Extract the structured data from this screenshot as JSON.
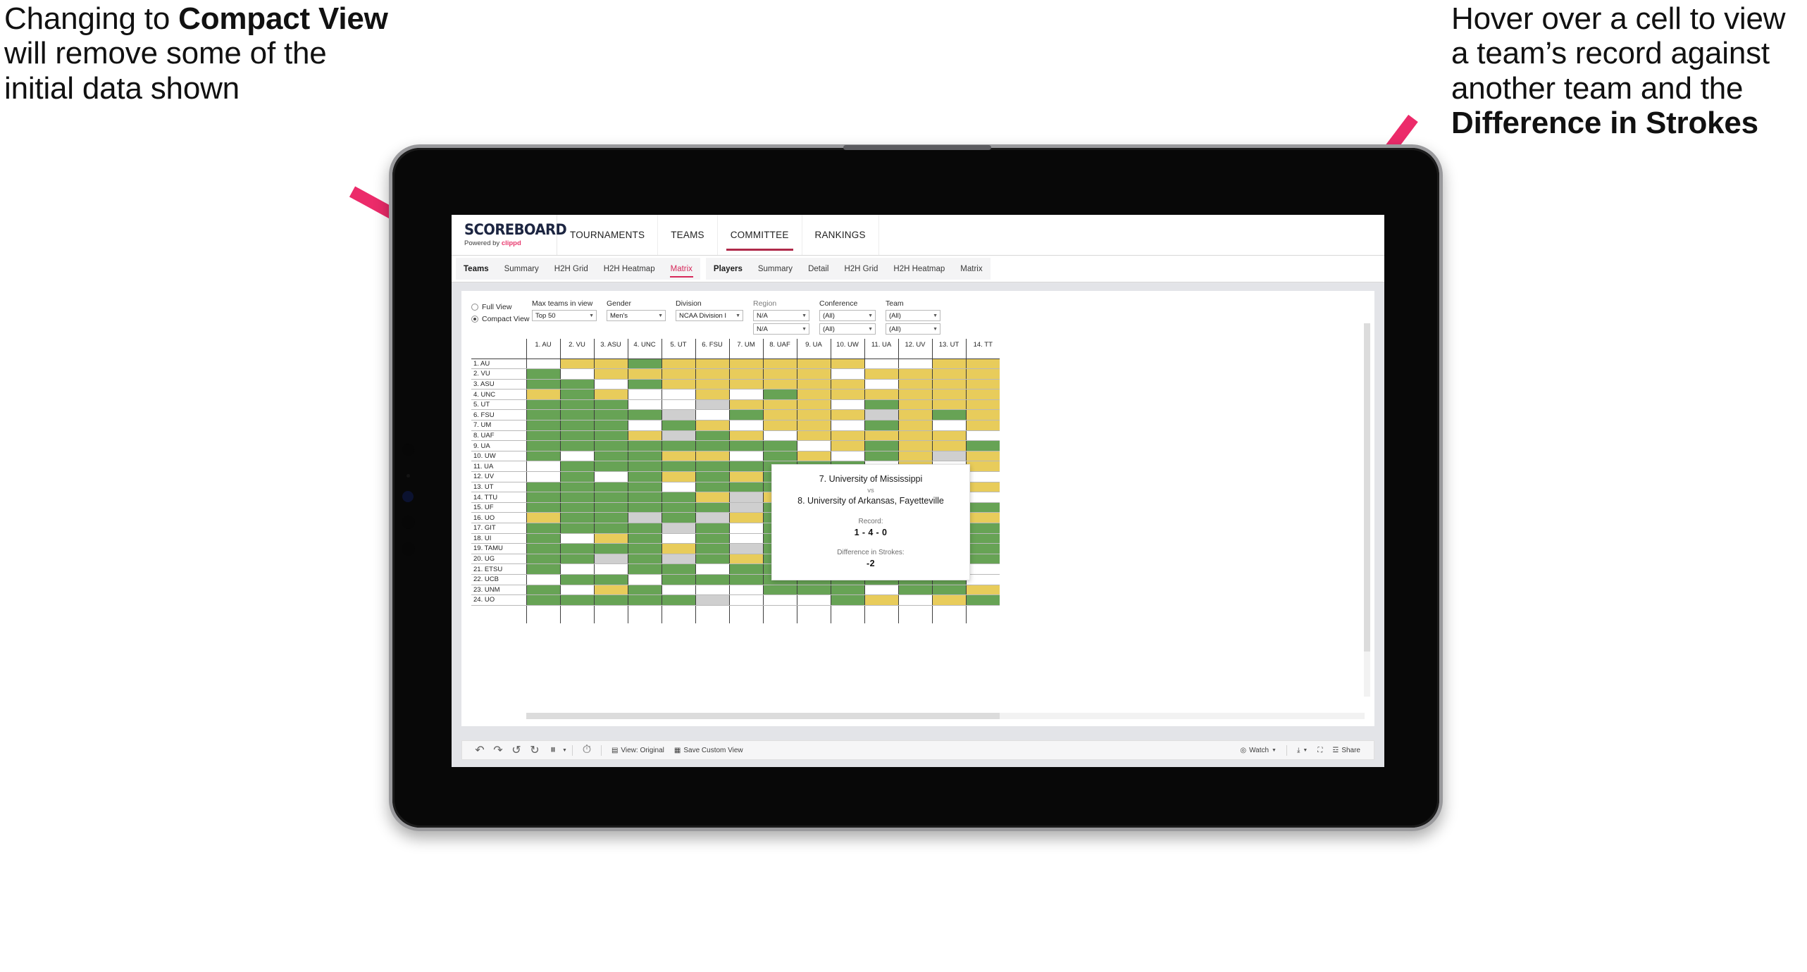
{
  "annotations": {
    "left": {
      "name": "compact-view-callout",
      "segments": [
        {
          "text": "Changing to ",
          "bold": false
        },
        {
          "text": "Compact View",
          "bold": true
        },
        {
          "text": " will remove some of the initial data shown",
          "bold": false
        }
      ]
    },
    "right": {
      "name": "hover-cell-callout",
      "segments": [
        {
          "text": "Hover over a cell to view a team’s record against another team and the ",
          "bold": false
        },
        {
          "text": "Difference in Strokes",
          "bold": true
        }
      ]
    },
    "arrow_color": "#ec2b6a"
  },
  "app": {
    "brand": {
      "logo": "SCOREBOARD",
      "powered_prefix": "Powered by ",
      "powered_brand": "clippd"
    },
    "nav": [
      {
        "label": "TOURNAMENTS",
        "active": false
      },
      {
        "label": "TEAMS",
        "active": false
      },
      {
        "label": "COMMITTEE",
        "active": true
      },
      {
        "label": "RANKINGS",
        "active": false
      }
    ],
    "tab_groups": [
      {
        "name": "teams-tabs",
        "items": [
          {
            "label": "Teams",
            "head": true,
            "selected": false
          },
          {
            "label": "Summary",
            "head": false,
            "selected": false
          },
          {
            "label": "H2H Grid",
            "head": false,
            "selected": false
          },
          {
            "label": "H2H Heatmap",
            "head": false,
            "selected": false
          },
          {
            "label": "Matrix",
            "head": false,
            "selected": true
          }
        ]
      },
      {
        "name": "players-tabs",
        "items": [
          {
            "label": "Players",
            "head": true,
            "selected": false
          },
          {
            "label": "Summary",
            "head": false,
            "selected": false
          },
          {
            "label": "Detail",
            "head": false,
            "selected": false
          },
          {
            "label": "H2H Grid",
            "head": false,
            "selected": false
          },
          {
            "label": "H2H Heatmap",
            "head": false,
            "selected": false
          },
          {
            "label": "Matrix",
            "head": false,
            "selected": false
          }
        ]
      }
    ],
    "filters": {
      "view_mode": {
        "options": [
          {
            "label": "Full View",
            "selected": false
          },
          {
            "label": "Compact View",
            "selected": true
          }
        ]
      },
      "fields": [
        {
          "label": "Max teams in view",
          "dim": false,
          "width": "w92",
          "values": [
            "Top 50"
          ]
        },
        {
          "label": "Gender",
          "dim": false,
          "width": "w84",
          "values": [
            "Men's"
          ]
        },
        {
          "label": "Division",
          "dim": false,
          "width": "w96",
          "values": [
            "NCAA Division I"
          ]
        },
        {
          "label": "Region",
          "dim": true,
          "width": "w80",
          "values": [
            "N/A",
            "N/A"
          ]
        },
        {
          "label": "Conference",
          "dim": false,
          "width": "w80",
          "values": [
            "(All)",
            "(All)"
          ]
        },
        {
          "label": "Team",
          "dim": false,
          "width": "w78",
          "values": [
            "(All)",
            "(All)"
          ]
        }
      ]
    },
    "tooltip": {
      "team_a": "7. University of Mississippi",
      "vs": "vs",
      "team_b": "8. University of Arkansas, Fayetteville",
      "record_label": "Record:",
      "record_value": "1 - 4 - 0",
      "diff_label": "Difference in Strokes:",
      "diff_value": "-2"
    },
    "toolbar": {
      "icons": [
        "undo-icon",
        "redo-icon",
        "revert-icon",
        "refresh-icon",
        "pause-icon",
        "alerts-icon"
      ],
      "items": [
        {
          "name": "view-original-button",
          "icon": "view-icon",
          "label": "View: Original"
        },
        {
          "name": "save-custom-view-button",
          "icon": "save-view-icon",
          "label": "Save Custom View"
        },
        {
          "name": "watch-button",
          "icon": "watch-icon",
          "label": "Watch",
          "caret": true
        },
        {
          "name": "download-button",
          "icon": "download-icon",
          "label": "",
          "caret": true
        },
        {
          "name": "fullscreen-button",
          "icon": "fullscreen-icon",
          "label": ""
        },
        {
          "name": "share-button",
          "icon": "share-icon",
          "label": "Share"
        }
      ]
    }
  },
  "chart_data": {
    "type": "heatmap",
    "title": "Head-to-Head Team Matrix",
    "legend": {
      "green": "#67a355",
      "yellow": "#e8cc5b",
      "gray": "#cfcfcf",
      "white": "#ffffff"
    },
    "xlabel": "",
    "ylabel": "",
    "columns": [
      "1. AU",
      "2. VU",
      "3. ASU",
      "4. UNC",
      "5. UT",
      "6. FSU",
      "7. UM",
      "8. UAF",
      "9. UA",
      "10. UW",
      "11. UA",
      "12. UV",
      "13. UT",
      "14. TT"
    ],
    "rows": [
      "1. AU",
      "2. VU",
      "3. ASU",
      "4. UNC",
      "5. UT",
      "6. FSU",
      "7. UM",
      "8. UAF",
      "9. UA",
      "10. UW",
      "11. UA",
      "12. UV",
      "13. UT",
      "14. TTU",
      "15. UF",
      "16. UO",
      "17. GIT",
      "18. UI",
      "19. TAMU",
      "20. UG",
      "21. ETSU",
      "22. UCB",
      "23. UNM",
      "24. UO"
    ],
    "cells": [
      [
        "w",
        "y",
        "y",
        "g",
        "y",
        "y",
        "y",
        "y",
        "y",
        "y",
        "w",
        "w",
        "y",
        "y"
      ],
      [
        "g",
        "w",
        "y",
        "y",
        "y",
        "y",
        "y",
        "y",
        "y",
        "w",
        "y",
        "y",
        "y",
        "y"
      ],
      [
        "g",
        "g",
        "w",
        "g",
        "y",
        "y",
        "y",
        "y",
        "y",
        "y",
        "w",
        "y",
        "y",
        "y"
      ],
      [
        "y",
        "g",
        "y",
        "w",
        "w",
        "y",
        "w",
        "g",
        "y",
        "y",
        "y",
        "y",
        "y",
        "y"
      ],
      [
        "g",
        "g",
        "g",
        "w",
        "w",
        "a",
        "y",
        "y",
        "y",
        "w",
        "g",
        "y",
        "y",
        "y"
      ],
      [
        "g",
        "g",
        "g",
        "g",
        "a",
        "w",
        "g",
        "y",
        "y",
        "y",
        "a",
        "y",
        "g",
        "y"
      ],
      [
        "g",
        "g",
        "g",
        "w",
        "g",
        "y",
        "w",
        "y",
        "y",
        "w",
        "g",
        "y",
        "w",
        "y"
      ],
      [
        "g",
        "g",
        "g",
        "y",
        "a",
        "g",
        "y",
        "w",
        "y",
        "y",
        "y",
        "y",
        "y",
        "w"
      ],
      [
        "g",
        "g",
        "g",
        "g",
        "g",
        "g",
        "g",
        "g",
        "w",
        "y",
        "g",
        "y",
        "y",
        "g"
      ],
      [
        "g",
        "w",
        "g",
        "g",
        "y",
        "y",
        "w",
        "g",
        "y",
        "w",
        "g",
        "y",
        "a",
        "y"
      ],
      [
        "w",
        "g",
        "g",
        "g",
        "g",
        "g",
        "g",
        "g",
        "g",
        "g",
        "w",
        "y",
        "w",
        "y"
      ],
      [
        "w",
        "g",
        "w",
        "g",
        "y",
        "g",
        "y",
        "g",
        "g",
        "g",
        "g",
        "w",
        "w",
        "w"
      ],
      [
        "g",
        "g",
        "g",
        "g",
        "w",
        "g",
        "g",
        "g",
        "g",
        "g",
        "g",
        "g",
        "w",
        "y"
      ],
      [
        "g",
        "g",
        "g",
        "g",
        "g",
        "y",
        "a",
        "y",
        "g",
        "g",
        "g",
        "a",
        "g",
        "w"
      ],
      [
        "g",
        "g",
        "g",
        "g",
        "g",
        "g",
        "a",
        "g",
        "g",
        "g",
        "g",
        "y",
        "g",
        "g"
      ],
      [
        "y",
        "g",
        "g",
        "a",
        "g",
        "a",
        "y",
        "g",
        "g",
        "g",
        "y",
        "g",
        "y",
        "y"
      ],
      [
        "g",
        "g",
        "g",
        "g",
        "a",
        "g",
        "w",
        "g",
        "g",
        "g",
        "g",
        "g",
        "w",
        "g"
      ],
      [
        "g",
        "w",
        "y",
        "g",
        "w",
        "g",
        "w",
        "g",
        "g",
        "g",
        "g",
        "g",
        "w",
        "g"
      ],
      [
        "g",
        "g",
        "g",
        "g",
        "y",
        "g",
        "a",
        "g",
        "g",
        "g",
        "g",
        "g",
        "g",
        "g"
      ],
      [
        "g",
        "g",
        "a",
        "g",
        "a",
        "g",
        "y",
        "g",
        "g",
        "g",
        "y",
        "g",
        "y",
        "g"
      ],
      [
        "g",
        "w",
        "w",
        "g",
        "g",
        "w",
        "g",
        "g",
        "g",
        "g",
        "g",
        "g",
        "g",
        "w"
      ],
      [
        "w",
        "g",
        "g",
        "w",
        "g",
        "g",
        "g",
        "g",
        "g",
        "g",
        "g",
        "g",
        "g",
        "w"
      ],
      [
        "g",
        "w",
        "y",
        "g",
        "w",
        "w",
        "w",
        "g",
        "g",
        "g",
        "w",
        "g",
        "g",
        "y"
      ],
      [
        "g",
        "g",
        "g",
        "g",
        "g",
        "a",
        "w",
        "w",
        "w",
        "g",
        "y",
        "w",
        "y",
        "g"
      ]
    ]
  }
}
